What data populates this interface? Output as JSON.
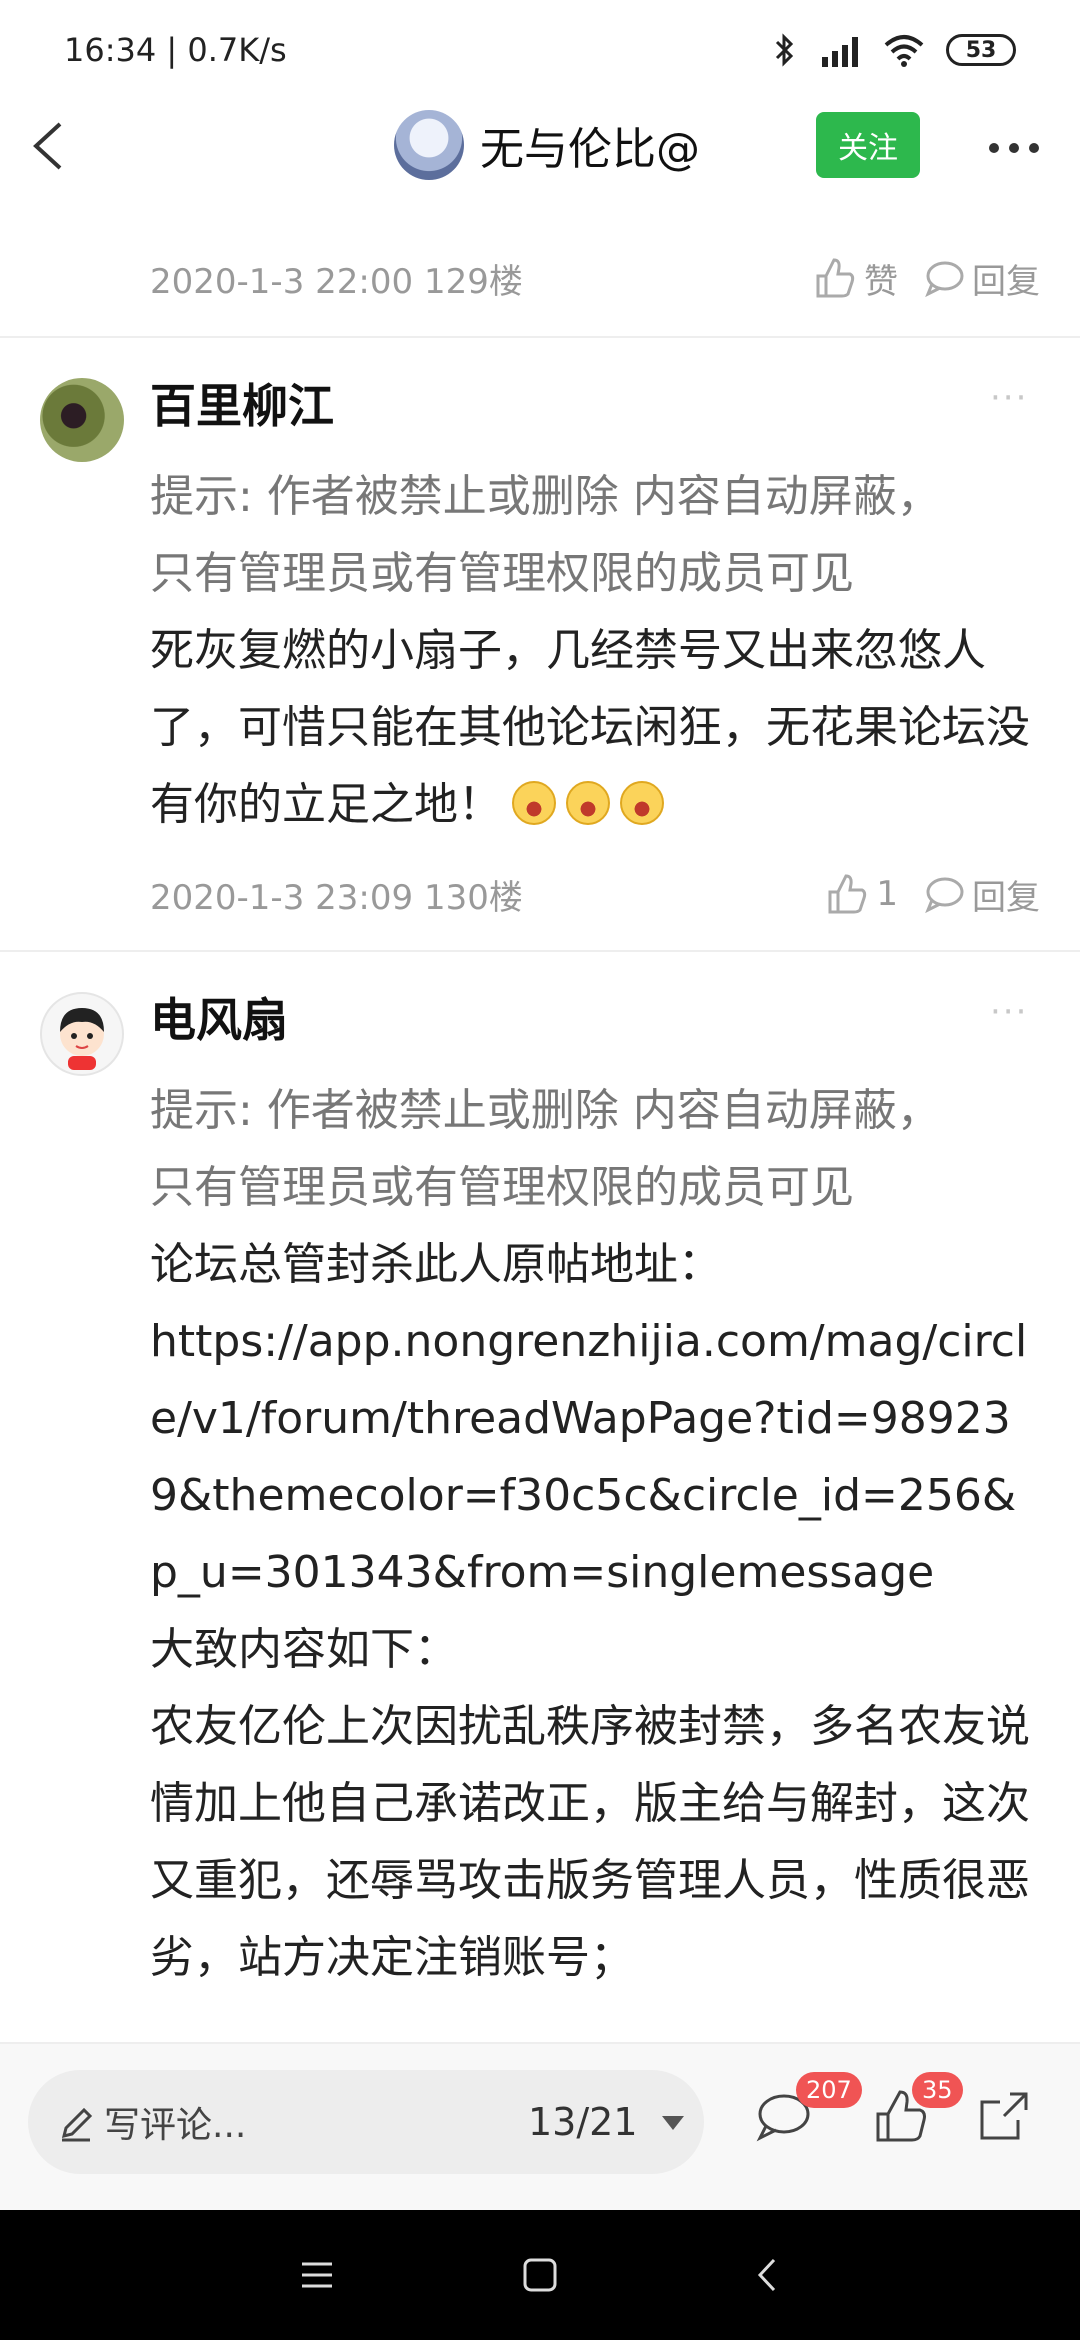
{
  "status": {
    "time": "16:34",
    "speed": "0.7K/s",
    "battery": "53",
    "icons": [
      "bluetooth-icon",
      "hd-signal-icon",
      "wifi-icon",
      "battery-icon"
    ]
  },
  "header": {
    "username": "无与伦比@",
    "follow_label": "关注"
  },
  "top_meta": {
    "date": "2020-1-3 22:00",
    "floor": "129楼",
    "like_label": "赞",
    "reply_label": "回复"
  },
  "posts": [
    {
      "username": "百里柳江",
      "hint_line1": "提示: 作者被禁止或删除 内容自动屏蔽，",
      "hint_line2": "只有管理员或有管理权限的成员可见",
      "content": "死灰复燃的小扇子，几经禁号又出来忽悠人了，可惜只能在其他论坛闲狂，无花果论坛没有你的立足之地！",
      "date": "2020-1-3 23:09",
      "floor": "130楼",
      "likes": "1",
      "reply_label": "回复"
    },
    {
      "username": "电风扇",
      "hint_line1": "提示: 作者被禁止或删除 内容自动屏蔽，",
      "hint_line2": "只有管理员或有管理权限的成员可见",
      "content_line1": "论坛总管封杀此人原帖地址：",
      "url": "https://app.nongrenzhijia.com/mag/circle/v1/forum/threadWapPage?tid=989239&themecolor=f30c5c&circle_id=256&p_u=301343&from=singlemessage",
      "content_line2": "大致内容如下：",
      "content_line3": "农友亿伦上次因扰乱秩序被封禁，多名农友说情加上他自己承诺改正，版主给与解封，这次又重犯，还辱骂攻击版务管理人员，性质很恶劣，站方决定注销账号；"
    }
  ],
  "bottom_bar": {
    "comment_placeholder": "写评论...",
    "page_indicator": "13/21",
    "comment_count": "207",
    "like_count": "35"
  }
}
